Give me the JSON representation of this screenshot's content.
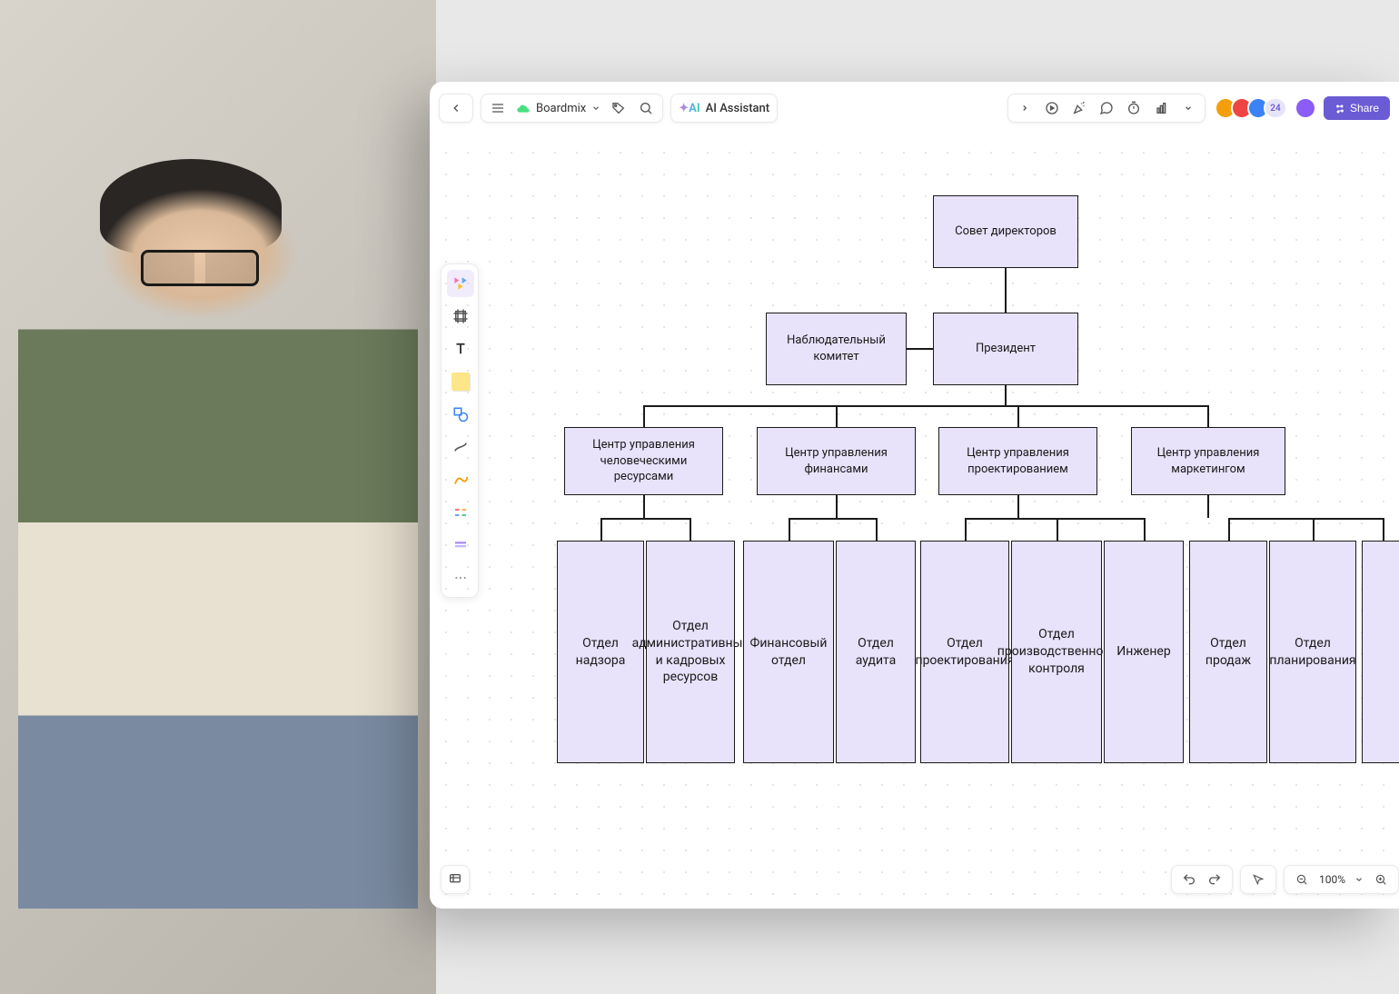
{
  "header": {
    "title": "Boardmix",
    "ai_label": "AI Assistant",
    "collaborator_count": "24",
    "share_label": "Share"
  },
  "org": {
    "board": "Совет директоров",
    "committee": "Наблюдательный комитет",
    "president": "Президент",
    "centers": {
      "hr": "Центр управления человеческими ресурсами",
      "fin": "Центр управления финансами",
      "eng": "Центр управления проектированием",
      "mkt": "Центр управления маркетингом"
    },
    "depts": {
      "supervision": "Отдел надзора",
      "admin_hr": "Отдел административных и кадровых ресурсов",
      "finance": "Финансовый отдел",
      "audit": "Отдел аудита",
      "design": "Отдел проектирования",
      "prod_ctrl": "Отдел производственного контроля",
      "engineer": "Инженер",
      "sales": "Отдел продаж",
      "planning": "Отдел планирования"
    }
  },
  "footer": {
    "zoom": "100%"
  }
}
